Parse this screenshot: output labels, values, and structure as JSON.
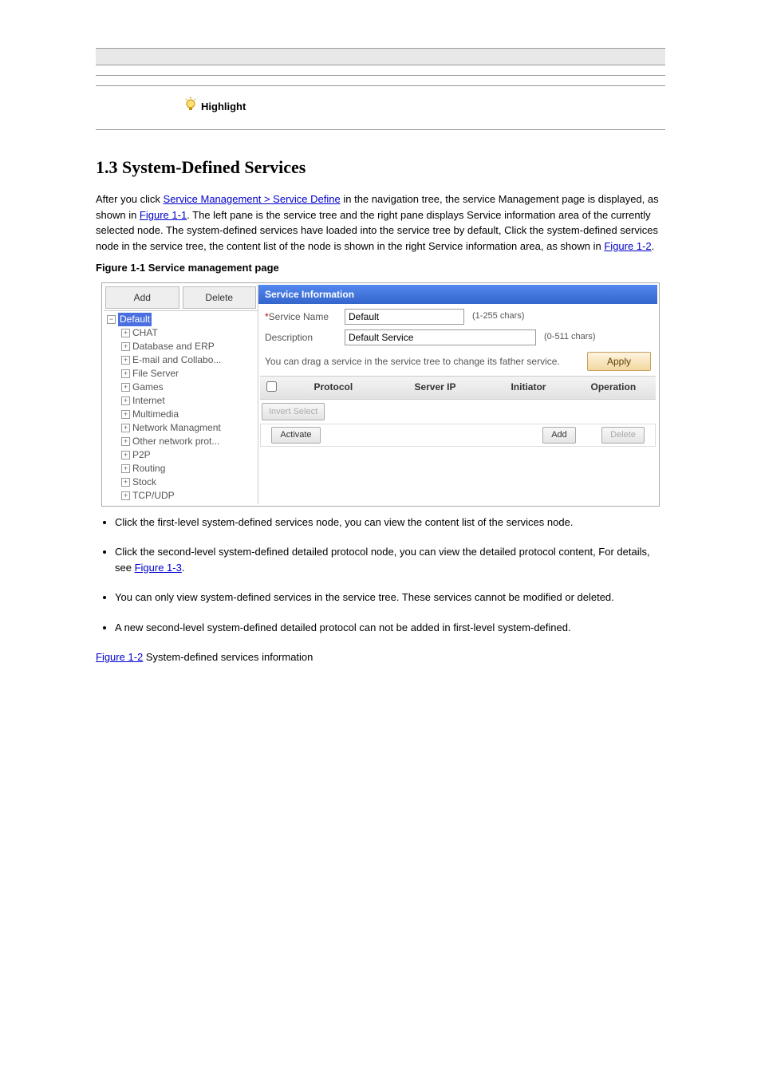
{
  "descTable": {
    "highlight_label": "Highlight"
  },
  "heading": "1.3 System-Defined Services",
  "para1_a": "After you click ",
  "para1_link": "Service Management > Service Define",
  "para1_b": " in the navigation tree, the service Management page is displayed, as shown in ",
  "para1_fig": "Figure 1-1",
  "para1_c": ". The left pane is the service tree and the right pane displays Service information area of the currently selected node. The system-defined services have loaded into the service tree by default, Click the system-defined services node in the service tree, the content list of the node is shown in the right Service information area, as shown in ",
  "para1_fig2": "Figure 1-2",
  "para1_d": ".",
  "fig1_caption": "Figure 1-1 Service management page",
  "figure": {
    "left": {
      "add": "Add",
      "delete": "Delete",
      "tree": {
        "root": "Default",
        "items": [
          "CHAT",
          "Database and ERP",
          "E-mail and Collabo...",
          "File Server",
          "Games",
          "Internet",
          "Multimedia",
          "Network Managment",
          "Other network prot...",
          "P2P",
          "Routing",
          "Stock",
          "TCP/UDP"
        ]
      }
    },
    "right": {
      "title": "Service Information",
      "svc_name_lbl": "Service Name",
      "svc_name_val": "Default",
      "svc_name_chars": "(1-255  chars)",
      "desc_lbl": "Description",
      "desc_val": "Default Service",
      "desc_chars": "(0-511  chars)",
      "drag_msg": "You can drag a service in the service tree to change its father service.",
      "apply": "Apply",
      "cols": {
        "protocol": "Protocol",
        "server_ip": "Server IP",
        "initiator": "Initiator",
        "operation": "Operation"
      },
      "invert": "Invert Select",
      "activate": "Activate",
      "add_btn": "Add",
      "del_btn": "Delete"
    }
  },
  "bullets": {
    "b1": "Click the first-level system-defined services node, you can view the content list of the services node.",
    "b2_a": "Click the second-level system-defined detailed protocol node, you can view the detailed protocol content, For details, see ",
    "b2_link": "Figure 1-3",
    "b2_b": ".",
    "b3": "You can only view system-defined services in the service tree. These services cannot be modified or deleted.",
    "b4": "A new second-level system-defined detailed protocol can not be added in first-level system-defined."
  },
  "fig2_caption_a": "Figure 1-2",
  "fig2_caption_b": " System-defined services information"
}
